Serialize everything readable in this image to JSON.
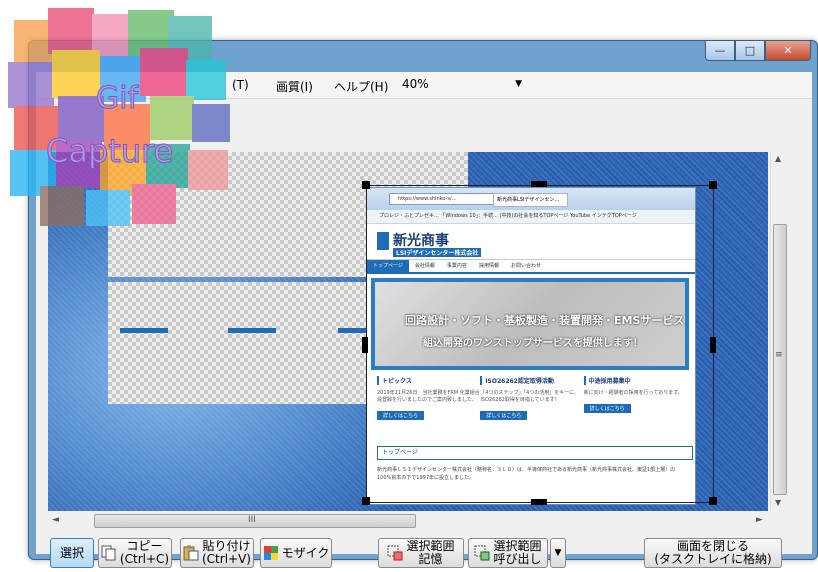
{
  "window": {
    "caption_buttons": {
      "minimize": "—",
      "maximize": "□",
      "close": "✕"
    },
    "menu": [
      "(T)",
      "画質(I)",
      "ヘルプ(H)"
    ],
    "zoom": "40%",
    "scroll": {
      "up": "▲",
      "down": "▼",
      "left": "◄",
      "right": "►",
      "grip": "≡",
      "hgrip": "III"
    }
  },
  "logo": {
    "line1": "Gif",
    "line2": "Capture"
  },
  "browser": {
    "url": "https://www.shinko-s/...",
    "tab": "新光商事LSIデザインセン...",
    "favorites": "プロレジ・ふとプレゼキ...    「Windows 10」：手続...    (中技)の社会を知るTOPページ    YouTube    インテグTOPページ",
    "company_name": "新光商事",
    "company_sub": "LSIデザインセンター株式会社",
    "nav": [
      "トップページ",
      "会社情報",
      "事業内容",
      "採用情報",
      "お問い合わせ"
    ],
    "hero_line1": "回路設計・ソフト・基板製造・装置開発・EMSサービス",
    "hero_line2": "組込開発のワンストップサービスを提供します！",
    "columns": [
      {
        "title": "トピックス",
        "text": "2019年11月26日　当社業務をFRM 化業組合員登録を行いましたのでご案内致しました。",
        "more": "詳しくはこちら"
      },
      {
        "title": "ISO26262認定取得活動",
        "text": "「4つのステップ」「4つの活用」をキーに、ISO26262取得を目指しています！",
        "more": "詳しくはこちら"
      },
      {
        "title": "中途採用募集中",
        "text": "新に向け・経験者の採用を行っております。",
        "more": "詳しくはこちら"
      }
    ],
    "toppage": "トップページ",
    "footer": "新光商事ＬＳＩデザインセンター株式会社（略称名：ＳＬＤ）は、半導体商社である新光商事（新光商事株式会社、東証1部上場）の100%資本の下で1997年に設立しました。"
  },
  "buttons": {
    "select": "選択",
    "copy": [
      "コピー",
      "(Ctrl+C)"
    ],
    "paste": [
      "貼り付け",
      "(Ctrl+V)"
    ],
    "mosaic": "モザイク",
    "remember": [
      "選択範囲",
      "記憶"
    ],
    "recall": [
      "選択範囲",
      "呼び出し"
    ],
    "dropdown": "▼",
    "close_screen": [
      "画面を閉じる",
      "(タスクトレイに格納)"
    ]
  }
}
